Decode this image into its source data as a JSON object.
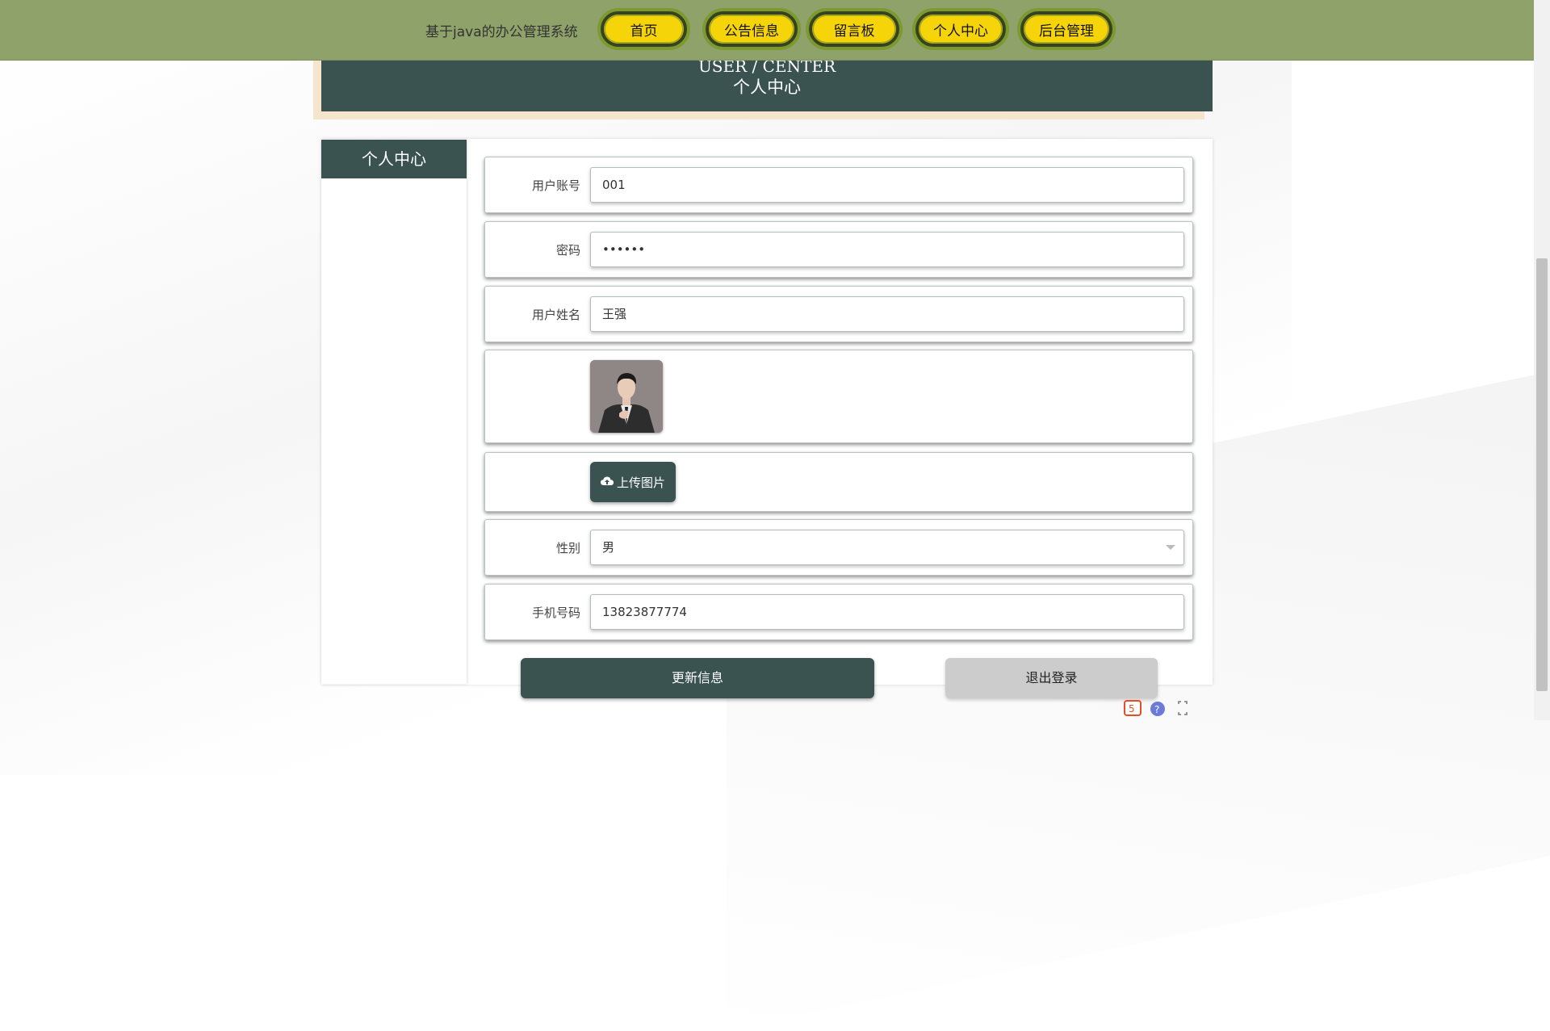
{
  "site": {
    "title": "基于java的办公管理系统"
  },
  "nav": {
    "items": [
      {
        "label": "首页"
      },
      {
        "label": "公告信息"
      },
      {
        "label": "留言板"
      },
      {
        "label": "个人中心"
      },
      {
        "label": "后台管理"
      }
    ]
  },
  "header": {
    "en": "USER / CENTER",
    "cn": "个人中心"
  },
  "sidebar": {
    "title": "个人中心"
  },
  "form": {
    "account": {
      "label": "用户账号",
      "value": "001"
    },
    "password": {
      "label": "密码",
      "value": "••••••"
    },
    "name": {
      "label": "用户姓名",
      "value": "王强"
    },
    "upload_label": "上传图片",
    "gender": {
      "label": "性别",
      "value": "男"
    },
    "phone": {
      "label": "手机号码",
      "value": "13823877774"
    }
  },
  "actions": {
    "update": "更新信息",
    "logout": "退出登录"
  },
  "colors": {
    "nav_bg": "#8ea26a",
    "nav_pill": "#f6d40a",
    "primary": "#3a5250",
    "band_border": "#f5e5cc"
  }
}
